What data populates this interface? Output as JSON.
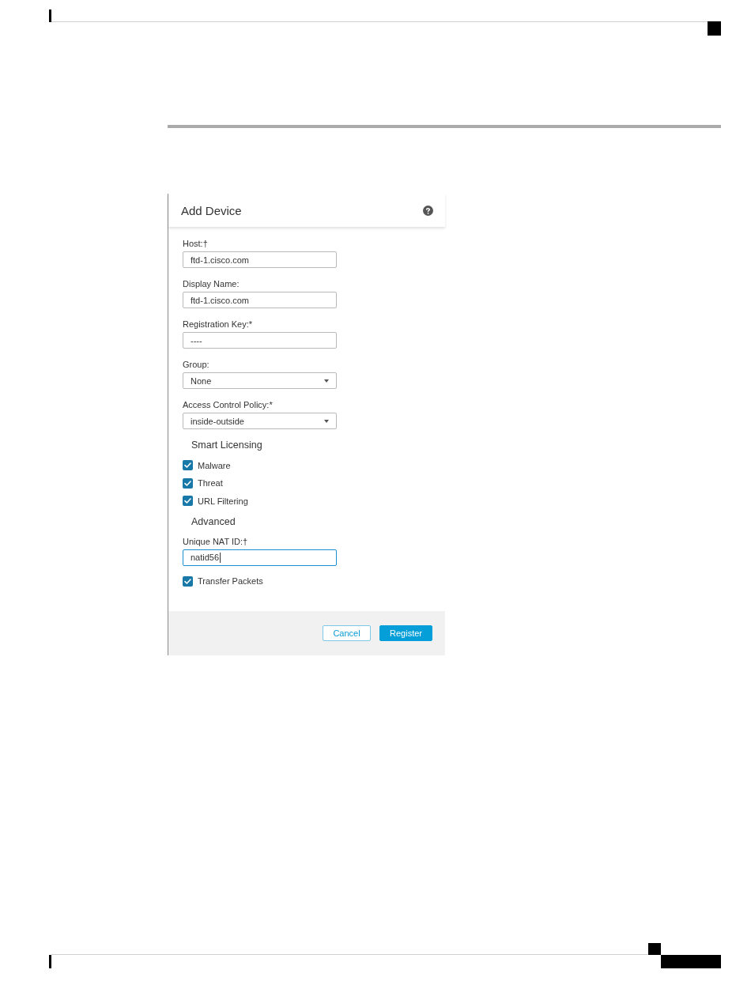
{
  "dialog": {
    "title": "Add Device",
    "items": [
      {
        "kind": "input",
        "label": "Host:†",
        "value": "ftd-1.cisco.com",
        "focused": false
      },
      {
        "kind": "input",
        "label": "Display Name:",
        "value": "ftd-1.cisco.com",
        "focused": false
      },
      {
        "kind": "input",
        "label": "Registration Key:*",
        "value": "----",
        "focused": false
      },
      {
        "kind": "select",
        "label": "Group:",
        "value": "None",
        "focused": false
      },
      {
        "kind": "select",
        "label": "Access Control Policy:*",
        "value": "inside-outside",
        "focused": false
      },
      {
        "kind": "heading",
        "label": "Smart Licensing"
      },
      {
        "kind": "checkbox",
        "label": "Malware",
        "checked": true
      },
      {
        "kind": "checkbox",
        "label": "Threat",
        "checked": true
      },
      {
        "kind": "checkbox",
        "label": "URL Filtering",
        "checked": true
      },
      {
        "kind": "heading",
        "label": "Advanced"
      },
      {
        "kind": "input",
        "label": "Unique NAT ID:†",
        "value": "natid56",
        "focused": true
      },
      {
        "kind": "checkbox",
        "label": "Transfer Packets",
        "checked": true
      }
    ],
    "buttons": [
      {
        "label": "Cancel",
        "kind": "secondary"
      },
      {
        "label": "Register",
        "kind": "primary"
      }
    ]
  }
}
